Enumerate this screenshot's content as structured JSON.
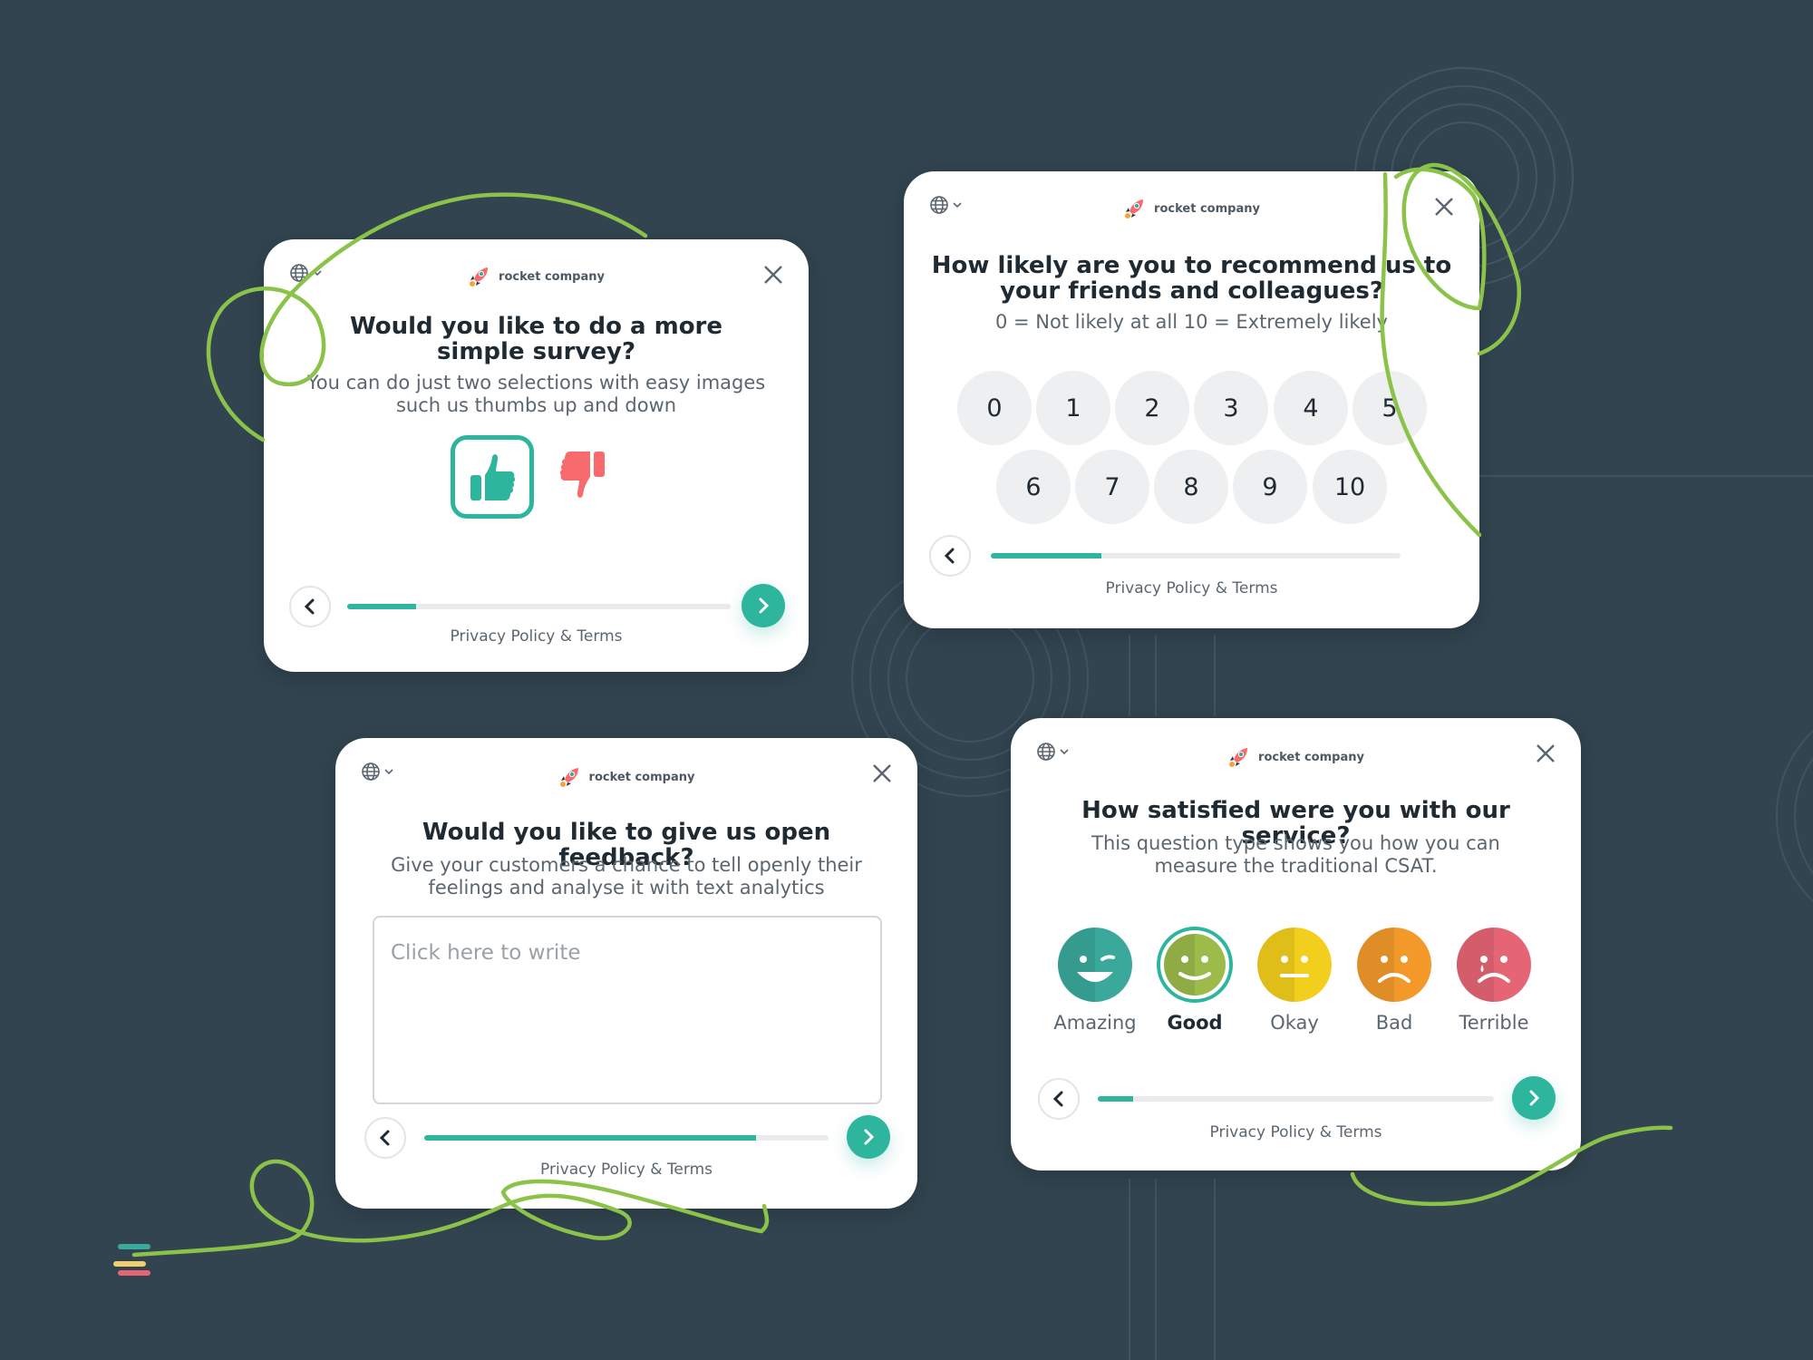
{
  "colors": {
    "background": "#31444f",
    "accent": "#2db59e",
    "doodle": "#8bc34a",
    "thumb_down": "#f76b6f",
    "track": "#e9ebec"
  },
  "brand": {
    "name": "rocket company",
    "icon": "rocket-icon"
  },
  "common": {
    "language_icon": "globe-icon",
    "close_icon": "close-icon",
    "back_icon": "chevron-left-icon",
    "next_icon": "chevron-right-icon",
    "privacy_label": "Privacy Policy & Terms"
  },
  "cards": {
    "thumbs": {
      "title": "Would you like to do a more simple survey?",
      "subtitle_line1": "You can do just two selections with easy images",
      "subtitle_line2": "such us thumbs up and down",
      "options": [
        {
          "label": "thumbs up",
          "icon": "thumbs-up-icon",
          "selected": true
        },
        {
          "label": "thumbs down",
          "icon": "thumbs-down-icon",
          "selected": false
        }
      ],
      "progress": 0.18,
      "has_next": true
    },
    "nps": {
      "title_line1": "How likely are you to recommend us to",
      "title_line2": "your friends and colleagues?",
      "subtitle": "0 = Not likely at all 10 = Extremely likely",
      "scale": [
        "0",
        "1",
        "2",
        "3",
        "4",
        "5",
        "6",
        "7",
        "8",
        "9",
        "10"
      ],
      "progress": 0.27,
      "has_next": false
    },
    "open": {
      "title": "Would you like to give us open feedback?",
      "subtitle_line1": "Give your customers a chance to tell openly their",
      "subtitle_line2": "feelings and analyse it with text analytics",
      "input_value": "",
      "input_placeholder": "Click here to write",
      "progress": 0.82,
      "has_next": true
    },
    "csat": {
      "title": "How satisfied were you with our service?",
      "subtitle_line1": "This question type shows you how you can",
      "subtitle_line2": "measure the traditional CSAT.",
      "options": [
        {
          "label": "Amazing",
          "icon": "amazing-face-icon",
          "color": "#3aa99c",
          "selected": false
        },
        {
          "label": "Good",
          "icon": "good-face-icon",
          "color": "#9cbb4a",
          "selected": true
        },
        {
          "label": "Okay",
          "icon": "okay-face-icon",
          "color": "#f2cf1d",
          "selected": false
        },
        {
          "label": "Bad",
          "icon": "bad-face-icon",
          "color": "#f2992a",
          "selected": false
        },
        {
          "label": "Terrible",
          "icon": "terrible-face-icon",
          "color": "#e56574",
          "selected": false
        }
      ],
      "progress": 0.09,
      "has_next": true
    }
  }
}
